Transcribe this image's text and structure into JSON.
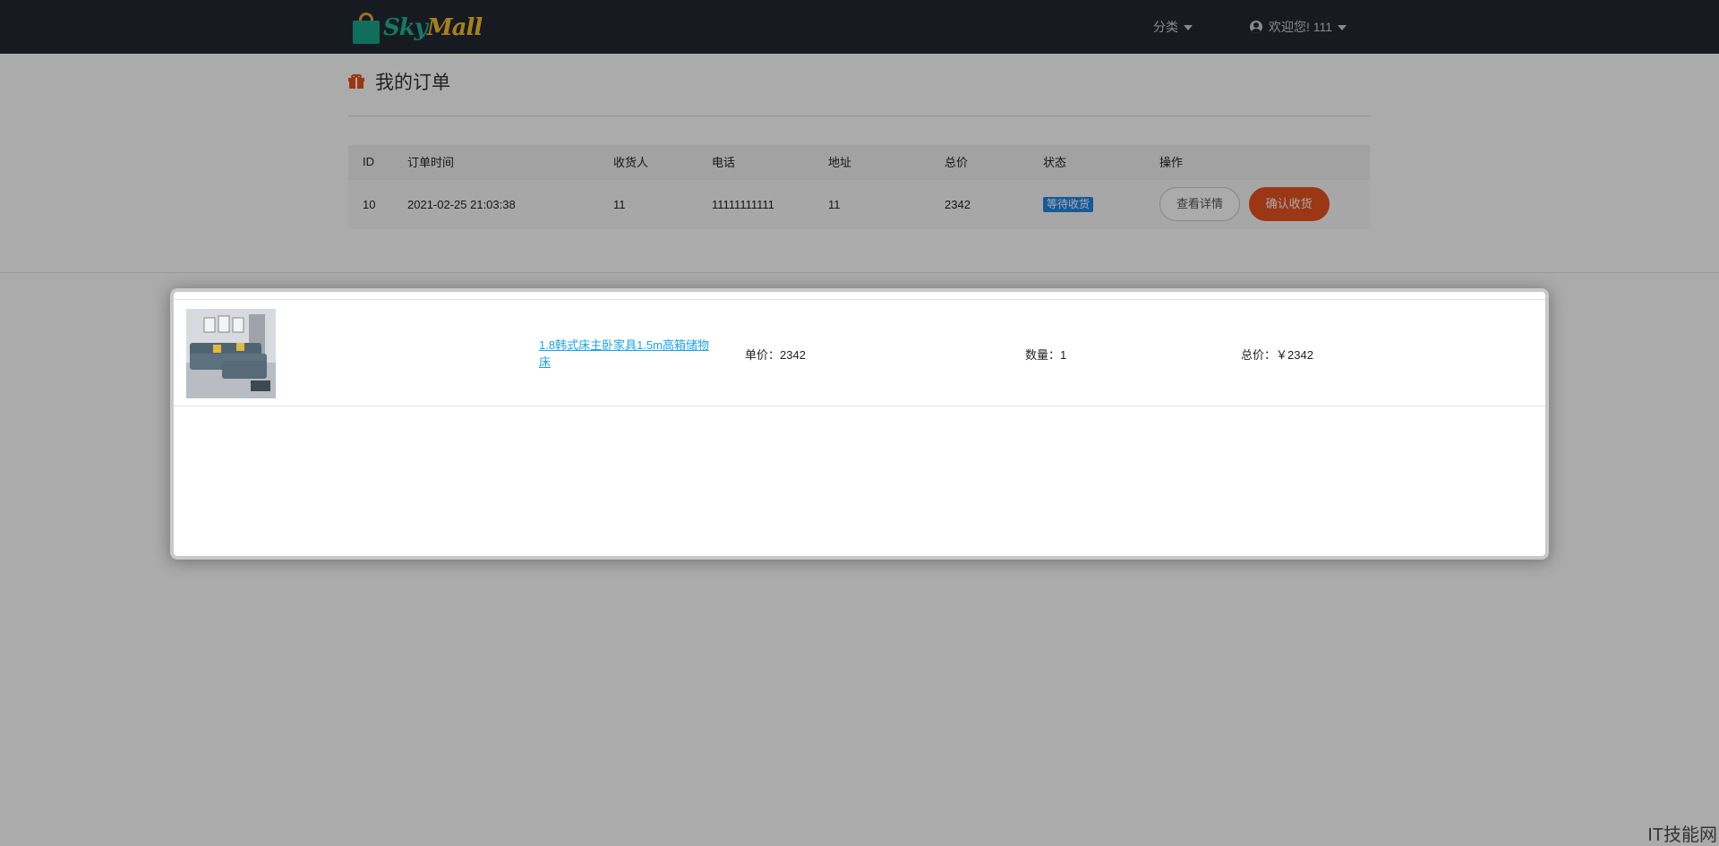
{
  "navbar": {
    "logo": {
      "part1": "Sky",
      "part2": "Mall"
    },
    "category_label": "分类",
    "user_greeting": "欢迎您! 111"
  },
  "page": {
    "title": "我的订单"
  },
  "orders_table": {
    "headers": [
      "ID",
      "订单时间",
      "收货人",
      "电话",
      "地址",
      "总价",
      "状态",
      "操作"
    ],
    "rows": [
      {
        "id": "10",
        "time": "2021-02-25 21:03:38",
        "receiver": "11",
        "phone": "11111111111",
        "address": "11",
        "total": "2342",
        "status": "等待收货",
        "view_label": "查看详情",
        "confirm_label": "确认收货"
      }
    ]
  },
  "modal": {
    "items": [
      {
        "name": "1.8韩式床主卧家具1.5m高箱储物床",
        "unit_price": "单价：2342",
        "quantity": "数量：1",
        "total": "总价：￥2342"
      }
    ]
  },
  "watermark": "IT技能网",
  "colors": {
    "navbar_bg": "#252833",
    "accent_orange": "#e8531e",
    "badge_blue": "#1e88e5",
    "link_blue": "#1aa3e8"
  }
}
